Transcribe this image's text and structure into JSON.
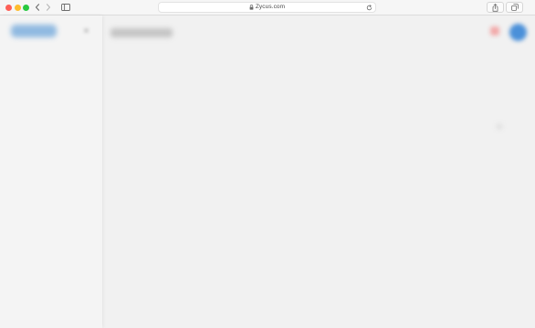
{
  "browser": {
    "url": "Zycus.com",
    "icons": {
      "back": "chevron-left-icon",
      "forward": "chevron-right-icon",
      "sidebar": "sidebar-icon",
      "lock": "lock-icon",
      "reload": "reload-icon",
      "share": "share-icon",
      "tabs": "tabs-overview-icon"
    },
    "traffic_lights": {
      "close": "#fe5f57",
      "minimize": "#febc2e",
      "zoom": "#28c840"
    }
  },
  "app": {
    "accent": "#4a90d9",
    "alert_color": "#f2a9a9",
    "logo_color": "#7fb0de"
  }
}
